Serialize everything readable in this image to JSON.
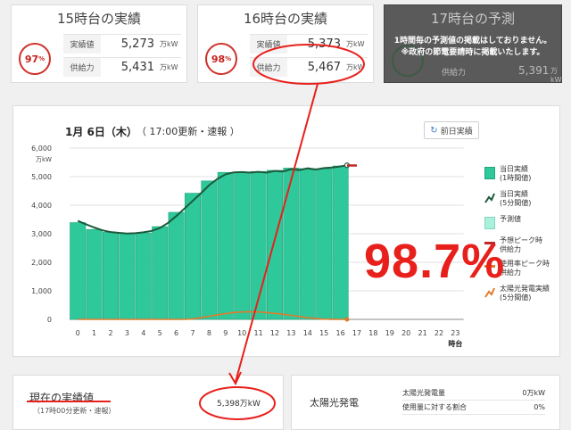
{
  "cards": {
    "h15": {
      "title": "15時台の実績",
      "percent": "97",
      "percent_unit": "%",
      "actual_label": "実績値",
      "actual_value": "5,273",
      "supply_label": "供給力",
      "supply_value": "5,431",
      "unit": "万kW"
    },
    "h16": {
      "title": "16時台の実績",
      "percent": "98",
      "percent_unit": "%",
      "actual_label": "実績値",
      "actual_value": "5,373",
      "supply_label": "供給力",
      "supply_value": "5,467",
      "unit": "万kW"
    },
    "h17": {
      "title": "17時台の予測",
      "notice_line1": "1時間毎の予測値の掲載はしておりません。",
      "notice_line2": "※政府の節電要請時に掲載いたします。",
      "supply_label": "供給力",
      "supply_value": "5,391",
      "unit": "万kW"
    }
  },
  "chart_header": {
    "date": "1月 6日（木）",
    "update": "（ 17:00更新・速報 ）",
    "prev_button": "前日実績",
    "refresh_icon": "refresh-icon"
  },
  "legend": [
    {
      "label": "当日実績\n(1時間値)",
      "color": "#2ec89a"
    },
    {
      "label": "当日実績\n(5分間値)",
      "color": "#1c5a3c"
    },
    {
      "label": "予測値",
      "color": "#aaf0dc"
    },
    {
      "label": "予想ピーク時\n供給力",
      "color": "#c0282a"
    },
    {
      "label": "使用率ピーク時\n供給力",
      "color": "#e07b2a"
    },
    {
      "label": "太陽光発電実績\n(5分間値)",
      "color": "#e07b2a"
    }
  ],
  "big_percent": "98.7%",
  "current": {
    "title": "現在の実績値",
    "subtitle": "（17時00分更新・速報）",
    "value": "5,398万kW"
  },
  "solar": {
    "title": "太陽光発電",
    "gen_label": "太陽光発電量",
    "gen_value": "0万kW",
    "ratio_label": "使用量に対する割合",
    "ratio_value": "0%"
  },
  "colors": {
    "bar": "#2ec89a",
    "bar_border": "#22a47c",
    "line": "#1c5a3c",
    "solar": "#e07b2a",
    "supply": "#c0282a",
    "annotation": "#e8201c"
  },
  "chart_data": {
    "type": "bar",
    "title": "",
    "x_unit": "時台",
    "y_unit": "万kW",
    "categories": [
      "0",
      "1",
      "2",
      "3",
      "4",
      "5",
      "6",
      "7",
      "8",
      "9",
      "10",
      "11",
      "12",
      "13",
      "14",
      "15",
      "16",
      "17",
      "18",
      "19",
      "20",
      "21",
      "22",
      "23"
    ],
    "ylim": [
      0,
      6000
    ],
    "yticks": [
      "0",
      "1,000",
      "2,000",
      "3,000",
      "4,000",
      "5,000",
      "6,000"
    ],
    "series": [
      {
        "name": "当日実績(1時間値)",
        "values": [
          3390,
          3150,
          3050,
          3020,
          3030,
          3250,
          3750,
          4420,
          4850,
          5150,
          5150,
          5180,
          5220,
          5300,
          5280,
          5273,
          5373
        ]
      },
      {
        "name": "当日実績(5分間値)",
        "x": [
          0,
          0.5,
          1,
          1.5,
          2,
          2.5,
          3,
          3.5,
          4,
          4.5,
          5,
          5.5,
          6,
          6.5,
          7,
          7.5,
          8,
          8.5,
          9,
          9.5,
          10,
          10.5,
          11,
          11.5,
          12,
          12.5,
          13,
          13.5,
          14,
          14.5,
          15,
          15.5,
          16,
          16.4
        ],
        "values": [
          3450,
          3330,
          3220,
          3120,
          3060,
          3030,
          3010,
          3020,
          3050,
          3100,
          3200,
          3380,
          3620,
          3880,
          4150,
          4420,
          4700,
          4920,
          5080,
          5150,
          5160,
          5140,
          5170,
          5140,
          5200,
          5180,
          5260,
          5230,
          5290,
          5250,
          5300,
          5320,
          5360,
          5398
        ]
      },
      {
        "name": "太陽光発電実績(5分間値)",
        "x": [
          0,
          6.5,
          7,
          7.5,
          8,
          8.5,
          9,
          9.5,
          10,
          10.5,
          11,
          11.5,
          12,
          12.5,
          13,
          13.5,
          14,
          14.5,
          15,
          15.5,
          16,
          16.4
        ],
        "values": [
          0,
          0,
          20,
          60,
          110,
          160,
          200,
          240,
          260,
          270,
          260,
          240,
          210,
          180,
          140,
          100,
          60,
          30,
          10,
          3,
          0,
          0
        ]
      },
      {
        "name": "予想ピーク時供給力",
        "x": [
          16.4,
          17
        ],
        "values": [
          5391,
          5391
        ]
      }
    ],
    "grid": true,
    "legend_position": "right"
  }
}
